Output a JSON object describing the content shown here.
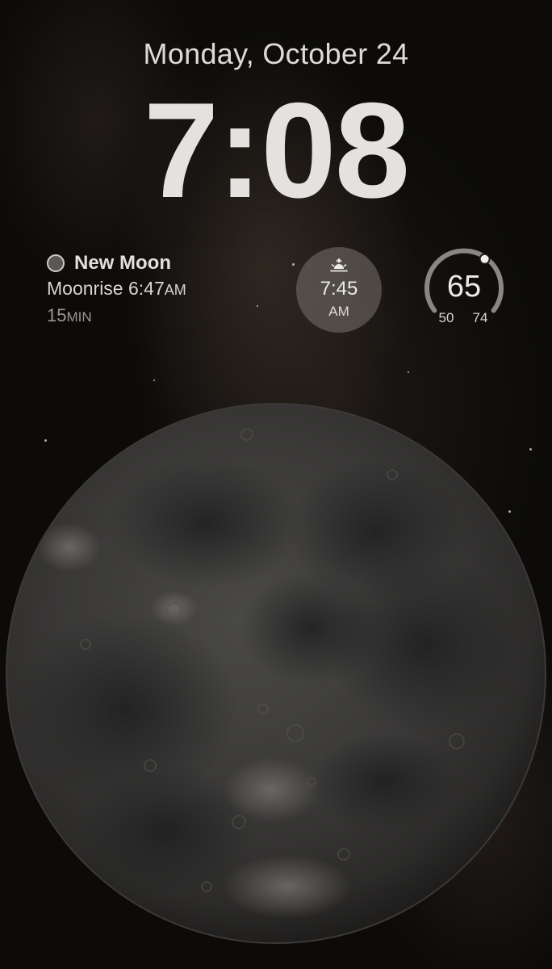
{
  "lock_screen": {
    "date": "Monday, October 24",
    "time": "7:08"
  },
  "moon_widget": {
    "phase_icon": "new-moon-icon",
    "phase_name": "New Moon",
    "moonrise_label": "Moonrise 6:47",
    "moonrise_ampm": "AM",
    "duration_value": "15",
    "duration_unit": "MIN"
  },
  "sunrise_widget": {
    "icon": "sunrise-icon",
    "time": "7:45",
    "ampm": "AM"
  },
  "weather_widget": {
    "current_temp": "65",
    "low_temp": "50",
    "high_temp": "74",
    "current_temp_fraction_of_range": 0.625
  },
  "wallpaper": {
    "subject": "moon-image"
  },
  "colors": {
    "background": "#0c0b0a",
    "text_primary": "#e4e2de",
    "text_secondary": "#9b9792",
    "widget_bg": "#78736e"
  }
}
